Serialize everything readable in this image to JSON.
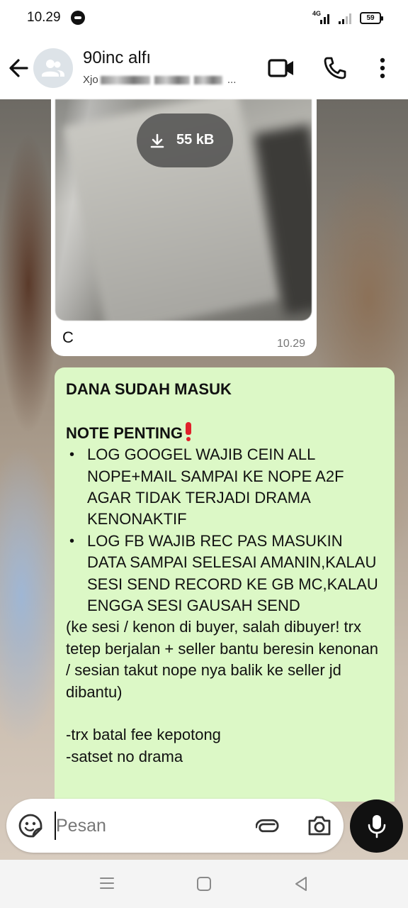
{
  "status_bar": {
    "time": "10.29",
    "network": "4G",
    "battery": "59"
  },
  "header": {
    "contact_name": "90inc alfı",
    "contact_subtitle_prefix": "Xjo",
    "contact_subtitle_suffix": "..."
  },
  "messages": {
    "image_message": {
      "download_size": "55 kB",
      "caption": "C",
      "time": "10.29"
    },
    "text_message": {
      "line1": "DANA SUDAH MASUK",
      "note_heading": "NOTE PENTING",
      "bullets": [
        "LOG GOOGEL WAJIB CEIN ALL NOPE+MAIL SAMPAI KE NOPE A2F AGAR TIDAK TERJADI DRAMA KENONAKTIF",
        "LOG FB WAJIB REC PAS MASUKIN DATA SAMPAI SELESAI AMANIN,KALAU SESI SEND RECORD KE GB MC,KALAU ENGGA SESI GAUSAH SEND"
      ],
      "paragraph": "(ke sesi / kenon di buyer, salah dibuyer! trx tetep berjalan + seller bantu beresin kenonan / sesian takut nope nya balik ke seller jd dibantu)",
      "extra_lines": [
        "-trx batal fee kepotong",
        "-satset no drama"
      ]
    }
  },
  "composer": {
    "placeholder": "Pesan"
  },
  "icons": {
    "back": "arrow-left-icon",
    "avatar": "group-avatar-icon",
    "video": "video-camera-icon",
    "call": "phone-icon",
    "more": "more-vertical-icon",
    "download": "download-icon",
    "sticker": "sticker-icon",
    "attach": "paperclip-icon",
    "camera": "camera-icon",
    "mic": "microphone-icon"
  },
  "colors": {
    "outgoing_bubble": "#dcf8c6",
    "incoming_bubble": "#ffffff",
    "alert_red": "#e0202a"
  }
}
